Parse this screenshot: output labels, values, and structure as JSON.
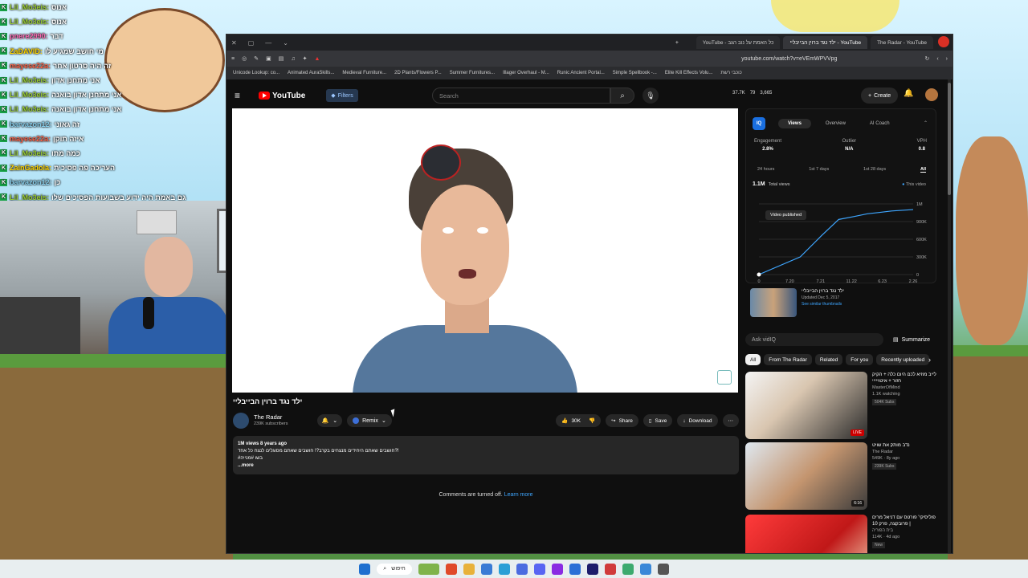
{
  "chat": [
    {
      "user": "Lil_Mo3eis",
      "msg": "אנוס",
      "color": "#9acd32"
    },
    {
      "user": "Lil_Mo3eis",
      "msg": "אנוס",
      "color": "#9acd32"
    },
    {
      "user": "pnere2990",
      "msg": "דבר",
      "color": "#ff69b4"
    },
    {
      "user": "ZaDAVID",
      "msg": "מי חושב שמגיע לו",
      "color": "#ffd700"
    },
    {
      "user": "mayese22a",
      "msg": "זה היה סרטון אחר",
      "color": "#ff6347"
    },
    {
      "user": "Lil_Mo3eis",
      "msg": "אני מתחנן אדון",
      "color": "#9acd32"
    },
    {
      "user": "Lil_Mo3eis",
      "msg": "אני מתחנן אדון בואנה",
      "color": "#9acd32"
    },
    {
      "user": "Lil_Mo3eis",
      "msg": "אני מתחנן אדון בואנה",
      "color": "#9acd32"
    },
    {
      "user": "barvazon12",
      "msg": "זה גאוני",
      "color": "#87ceeb"
    },
    {
      "user": "mayese22a",
      "msg": "איזה תוקן",
      "color": "#ff6347"
    },
    {
      "user": "Lil_Mo3eis",
      "msg": "כמה מתו",
      "color": "#9acd32"
    },
    {
      "user": "ZainGadola",
      "msg": "העריכה פה פסיכית",
      "color": "#ffd700"
    },
    {
      "user": "barvazon12",
      "msg": "כן",
      "color": "#87ceeb"
    },
    {
      "user": "Lil_Mo3eis",
      "msg": "גם באמת היה ידוע בשבועות הפסיכים שלו",
      "color": "#9acd32"
    }
  ],
  "browser": {
    "tabs": [
      "YouTube - כל האמת על נוב הגב",
      "ילד נגד ברוין הבייבליי - YouTube",
      "The Radar - YouTube"
    ],
    "url": "youtube.com/watch?v=eVEmWPVVpg",
    "bookmarks": [
      "Unicode Lookup: co...",
      "Animated AuraSkills...",
      "Medieval Furniture...",
      "2D Plants/Flowers P...",
      "Summer Furnitures...",
      "Illager Overhaul - M...",
      "Runic Ancient Portal...",
      "Simple Spellbook -...",
      "Elite Kill Effects Volu...",
      "כוכבי רשת"
    ]
  },
  "youtube": {
    "logo": "YouTube",
    "filters": "Filters",
    "search_placeholder": "Search",
    "stats": [
      "37.7K",
      "79",
      "3,665"
    ],
    "create": "Create",
    "video_title": "ילד נגד ברוין הבייבליי",
    "channel": {
      "name": "The Radar",
      "subs": "239K subscribers"
    },
    "remix": "Remix",
    "likes": "30K",
    "share": "Share",
    "save": "Save",
    "download": "Download",
    "desc_meta": "1M views  8 years ago",
    "desc_line": "חושבים שאתם היחידים מנצחים בקרב?! חושבים שאתם מסוגלים לנצח כל אחד?!",
    "desc_line2": "#בשו #מנייה",
    "more": "...more",
    "comments_off": "Comments are turned off.",
    "learn_more": "Learn more"
  },
  "vidiq": {
    "tabs": [
      "Views",
      "Overview",
      "AI Coach"
    ],
    "metrics": [
      {
        "label": "Engagement",
        "value": "2.8%"
      },
      {
        "label": "Outlier",
        "value": "N/A"
      },
      {
        "label": "VPH",
        "value": "0.8"
      }
    ],
    "periods": [
      "24 hours",
      "1st 7 days",
      "1st 28 days",
      "All"
    ],
    "total": "1.1M",
    "total_label": "Total views",
    "this_video": "This video",
    "published": "Video published",
    "y_ticks": [
      "1M",
      "900K",
      "600K",
      "300K",
      "0"
    ],
    "x_ticks": [
      "0",
      "7.20",
      "7.21",
      "11.22",
      "6.23",
      "2.26"
    ],
    "thumb_title": "ילד נגד ברוין הבייבליי",
    "thumb_updated": "Updated Dec 5, 2017",
    "thumb_similar": "See similar thumbnails",
    "ask": "Ask vidIQ",
    "summarize": "Summarize",
    "chart_points": [
      0,
      0.25,
      0.55,
      0.78,
      0.82,
      0.86,
      0.88,
      0.9,
      0.91,
      0.92
    ]
  },
  "chips": [
    "All",
    "From The Radar",
    "Related",
    "For you",
    "Recently uploaded"
  ],
  "recommended": [
    {
      "title": "לייב מוזיא לכם היום כלה + הקיק חזור + איטוייייי",
      "channel": "MasterOfMind",
      "meta": "1.1K watching",
      "badge": "504K Subs",
      "tag": "LIVE"
    },
    {
      "title": "נדב מותק את שויט",
      "channel": "The Radar",
      "meta": "549K · 8y ago",
      "badge": "239K Subs",
      "tag": "6:16"
    },
    {
      "title": "פוליסיקי' פורטס עם דניאל מרים | פרובקצה, פרק 10",
      "channel": "בית הפוריה",
      "meta": "114K · 4d ago",
      "badge": "New",
      "tag": ""
    }
  ],
  "taskbar": {
    "search": "חיפוש"
  }
}
